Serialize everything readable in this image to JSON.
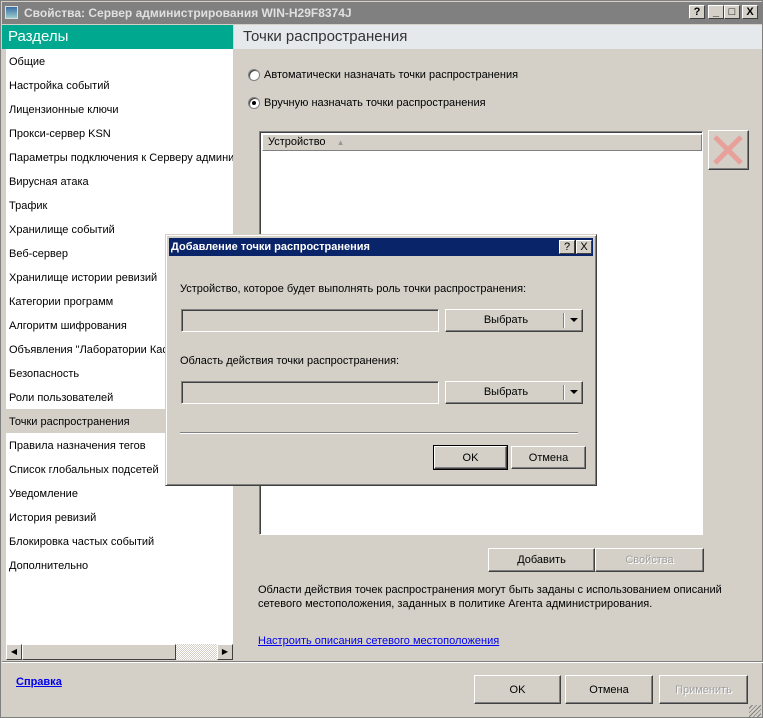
{
  "window": {
    "title": "Свойства: Сервер администрирования WIN-H29F8374J",
    "help": "?",
    "minimize": "_",
    "maximize": "□",
    "close": "X"
  },
  "sidebar": {
    "title": "Разделы",
    "selected_index": 15,
    "items": [
      {
        "label": "Общие"
      },
      {
        "label": "Настройка событий"
      },
      {
        "label": "Лицензионные ключи"
      },
      {
        "label": "Прокси-сервер KSN"
      },
      {
        "label": "Параметры подключения к Серверу администрирования"
      },
      {
        "label": "Вирусная атака"
      },
      {
        "label": "Трафик"
      },
      {
        "label": "Хранилище событий"
      },
      {
        "label": "Веб-сервер"
      },
      {
        "label": "Хранилище истории ревизий"
      },
      {
        "label": "Категории программ"
      },
      {
        "label": "Алгоритм шифрования"
      },
      {
        "label": "Объявления \"Лаборатории Касперского\""
      },
      {
        "label": "Безопасность"
      },
      {
        "label": "Роли пользователей"
      },
      {
        "label": "Точки распространения"
      },
      {
        "label": "Правила назначения тегов"
      },
      {
        "label": "Список глобальных подсетей"
      },
      {
        "label": "Уведомление"
      },
      {
        "label": "История ревизий"
      },
      {
        "label": "Блокировка частых событий"
      },
      {
        "label": "Дополнительно"
      }
    ]
  },
  "pane": {
    "title": "Точки распространения",
    "radio_auto": "Автоматически назначать точки распространения",
    "radio_manual": "Вручную назначать точки распространения",
    "selected_radio": "manual",
    "list_column": "Устройство",
    "add_button": "Добавить",
    "properties_button": "Свойства",
    "info_line1": "Области действия точек распространения могут быть заданы с использованием описаний",
    "info_line2": "сетевого местоположения, заданных в политике Агента администрирования.",
    "link": "Настроить описания сетевого местоположения"
  },
  "footer": {
    "help_link": "Справка",
    "ok": "OK",
    "cancel": "Отмена",
    "apply": "Применить"
  },
  "dialog": {
    "title": "Добавление точки распространения",
    "help": "?",
    "close": "X",
    "device_label": "Устройство, которое будет выполнять роль точки распространения:",
    "device_value": "",
    "device_button": "Выбрать",
    "scope_label": "Область действия точки распространения:",
    "scope_value": "",
    "scope_button": "Выбрать",
    "ok": "OK",
    "cancel": "Отмена"
  },
  "colors": {
    "section_header": "#00a88f",
    "dialog_title": "#0a246a",
    "link": "#0000ee",
    "delete_icon": "#e8a09a"
  }
}
